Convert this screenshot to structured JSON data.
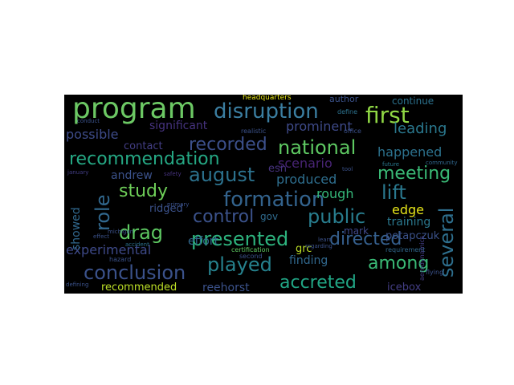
{
  "words": [
    {
      "text": "program",
      "color": "#6cc864"
    },
    {
      "text": "disruption",
      "color": "#3b7ea1"
    },
    {
      "text": "first",
      "color": "#8fd744"
    },
    {
      "text": "recommendation",
      "color": "#25a884"
    },
    {
      "text": "recorded",
      "color": "#3c508b"
    },
    {
      "text": "national",
      "color": "#5ec962"
    },
    {
      "text": "august",
      "color": "#2c728e"
    },
    {
      "text": "meeting",
      "color": "#3aba76"
    },
    {
      "text": "formation",
      "color": "#33638d"
    },
    {
      "text": "study",
      "color": "#6ece58"
    },
    {
      "text": "lift",
      "color": "#2a788e"
    },
    {
      "text": "control",
      "color": "#3b528b"
    },
    {
      "text": "public",
      "color": "#287d8e"
    },
    {
      "text": "role",
      "color": "#31688e"
    },
    {
      "text": "several",
      "color": "#2e6f8e"
    },
    {
      "text": "drag",
      "color": "#5ec962"
    },
    {
      "text": "presented",
      "color": "#2db27d"
    },
    {
      "text": "directed",
      "color": "#355f8d"
    },
    {
      "text": "experimental",
      "color": "#3e4a89"
    },
    {
      "text": "among",
      "color": "#3aba76"
    },
    {
      "text": "played",
      "color": "#26828e"
    },
    {
      "text": "conclusion",
      "color": "#3b528b"
    },
    {
      "text": "accreted",
      "color": "#21a685"
    },
    {
      "text": "leading",
      "color": "#2a788e"
    },
    {
      "text": "happened",
      "color": "#2c728e"
    },
    {
      "text": "prominent",
      "color": "#3e4a89"
    },
    {
      "text": "significant",
      "color": "#46337f"
    },
    {
      "text": "possible",
      "color": "#3e4c8a"
    },
    {
      "text": "contact",
      "color": "#433e85"
    },
    {
      "text": "andrew",
      "color": "#3b528b"
    },
    {
      "text": "scenario",
      "color": "#482475"
    },
    {
      "text": "produced",
      "color": "#2e6e8e"
    },
    {
      "text": "rough",
      "color": "#35b779"
    },
    {
      "text": "edge",
      "color": "#e5e419"
    },
    {
      "text": "esn",
      "color": "#46327e"
    },
    {
      "text": "ridged",
      "color": "#3b528b"
    },
    {
      "text": "gov",
      "color": "#2f6b8e"
    },
    {
      "text": "grc",
      "color": "#bddf26"
    },
    {
      "text": "effort",
      "color": "#31688e"
    },
    {
      "text": "mark",
      "color": "#3f4889"
    },
    {
      "text": "finding",
      "color": "#31688e"
    },
    {
      "text": "training",
      "color": "#2a788e"
    },
    {
      "text": "potapczuk",
      "color": "#3b528b"
    },
    {
      "text": "recommended",
      "color": "#bddf26"
    },
    {
      "text": "reehorst",
      "color": "#3b528b"
    },
    {
      "text": "icebox",
      "color": "#433e85"
    },
    {
      "text": "showed",
      "color": "#31688e"
    },
    {
      "text": "headquarters",
      "color": "#e5e419"
    },
    {
      "text": "author",
      "color": "#3b528b"
    },
    {
      "text": "continue",
      "color": "#2c728e"
    },
    {
      "text": "certification",
      "color": "#5ec962"
    },
    {
      "text": "requirement",
      "color": "#31688e"
    },
    {
      "text": "second",
      "color": "#3b528b"
    },
    {
      "text": "aerodynamics",
      "color": "#433e85"
    },
    {
      "text": "flying",
      "color": "#3b528b"
    },
    {
      "text": "future",
      "color": "#2a788e"
    },
    {
      "text": "community",
      "color": "#31688e"
    },
    {
      "text": "define",
      "color": "#2c728e"
    },
    {
      "text": "office",
      "color": "#3b528b"
    },
    {
      "text": "realistic",
      "color": "#3b528b"
    },
    {
      "text": "safety",
      "color": "#46337f"
    },
    {
      "text": "primary",
      "color": "#3b528b"
    },
    {
      "text": "hazard",
      "color": "#3b528b"
    },
    {
      "text": "accident",
      "color": "#2c728e"
    },
    {
      "text": "defining",
      "color": "#3b528b"
    },
    {
      "text": "january",
      "color": "#433e85"
    },
    {
      "text": "conduct",
      "color": "#3b528b"
    },
    {
      "text": "effect",
      "color": "#3b528b"
    },
    {
      "text": "regarding",
      "color": "#3b528b"
    },
    {
      "text": "learn",
      "color": "#3b528b"
    },
    {
      "text": "tool",
      "color": "#3b528b"
    },
    {
      "text": "michigan",
      "color": "#3b528b"
    }
  ]
}
